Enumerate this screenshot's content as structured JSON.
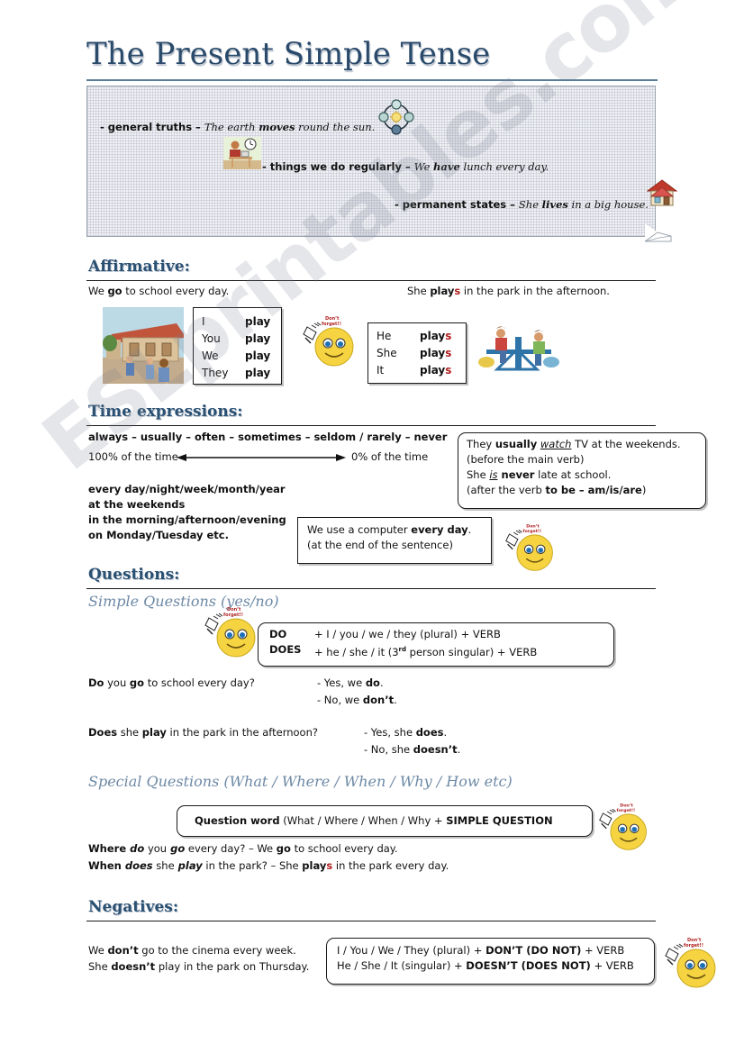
{
  "document": {
    "title": "The Present Simple Tense",
    "watermark": "ESLprintables.com"
  },
  "intro": {
    "lines": [
      {
        "prefix": "- general truths – ",
        "example_pre": "The earth ",
        "example_bold": "moves",
        "example_post": " round the sun."
      },
      {
        "prefix": "- things we do regularly – ",
        "example_pre": "We ",
        "example_bold": "have",
        "example_post": " lunch every day."
      },
      {
        "prefix": "- permanent states – ",
        "example_pre": "She ",
        "example_bold": "lives",
        "example_post": " in a big house."
      }
    ],
    "icons": [
      "earth-orbit-icon",
      "person-at-desk-icon",
      "house-icon"
    ]
  },
  "affirmative": {
    "heading": "Affirmative:",
    "left_sentence_pre": "We ",
    "left_sentence_bold": "go",
    "left_sentence_post": " to school every day.",
    "right_sentence_pre": "She ",
    "right_sentence_bold": "play",
    "right_sentence_bold_s": "s",
    "right_sentence_post": " in the park in the afternoon.",
    "table_left": [
      {
        "pronoun": "I",
        "verb": "play"
      },
      {
        "pronoun": "You",
        "verb": "play"
      },
      {
        "pronoun": "We",
        "verb": "play"
      },
      {
        "pronoun": "They",
        "verb": "play"
      }
    ],
    "table_right": [
      {
        "pronoun": "He",
        "verb": "play",
        "suffix": "s"
      },
      {
        "pronoun": "She",
        "verb": "play",
        "suffix": "s"
      },
      {
        "pronoun": "It",
        "verb": "play",
        "suffix": "s"
      }
    ]
  },
  "time_expressions": {
    "heading": "Time expressions:",
    "adverb_scale": "always – usually – often – sometimes – seldom / rarely – never",
    "scale_left": "100% of the time",
    "scale_right": "0% of the time",
    "expressions": [
      "every day/night/week/month/year",
      "at the weekends",
      "in the morning/afternoon/evening",
      "on Monday/Tuesday etc."
    ],
    "note_box_right": {
      "line1_pre": "They ",
      "line1_bold": "usually",
      "line1_mid": " ",
      "line1_underline": "watch",
      "line1_post": " TV at the weekends.",
      "line2": "(before the main verb)",
      "line3_pre": "She ",
      "line3_italic": "is",
      "line3_bold": " never",
      "line3_post": " late at school.",
      "line4_pre": "(after the verb ",
      "line4_bold": "to be – am/is/are",
      "line4_post": ")"
    },
    "note_box_bottom": {
      "line1_pre": "We use a computer ",
      "line1_bold": "every day",
      "line1_post": ".",
      "line2": "(at the end of the sentence)"
    }
  },
  "questions": {
    "heading": "Questions:",
    "simple_subhead": "Simple Questions (yes/no)",
    "do_box": {
      "rows": [
        {
          "aux": "DO",
          "pattern_pre": "+ I / you / we / they (plural) + VERB",
          "sup": "",
          "pattern_post": ""
        },
        {
          "aux": "DOES",
          "pattern_pre": "+ he / she / it (3",
          "sup": "rd",
          "pattern_post": " person singular) + VERB"
        }
      ]
    },
    "examples": [
      {
        "question_bold": "Do",
        "question_rest_pre": " you ",
        "question_rest_bold": "go",
        "question_rest_post": " to school every day?",
        "answer_yes_pre": "- Yes, we ",
        "answer_yes_bold": "do",
        "answer_yes_post": ".",
        "answer_no_pre": "- No, we ",
        "answer_no_bold": "don’t",
        "answer_no_post": "."
      },
      {
        "question_bold": "Does",
        "question_rest_pre": " she ",
        "question_rest_bold": "play",
        "question_rest_post": " in the park in the afternoon?",
        "answer_yes_pre": "- Yes, she ",
        "answer_yes_bold": "does",
        "answer_yes_post": ".",
        "answer_no_pre": "- No, she ",
        "answer_no_bold": "doesn’t",
        "answer_no_post": "."
      }
    ],
    "special_subhead": "Special Questions (What / Where / When / Why / How etc)",
    "special_box_bold": "Question word",
    "special_box_rest": " (What / Where / When / Why + ",
    "special_box_bold2": "SIMPLE QUESTION",
    "special_examples": [
      {
        "b1": "Where",
        "i1": " do",
        "n1": " you",
        "i2": " go",
        "n2": " every day? – We ",
        "b2": "go",
        "n3": " to school every day."
      },
      {
        "b1": "When",
        "i1": " does",
        "n1": " she",
        "i2": " play",
        "n2": " in the park? – She ",
        "b2": "play",
        "s": "s",
        "n3": " in the park every day."
      }
    ]
  },
  "negatives": {
    "heading": "Negatives:",
    "examples": [
      {
        "pre": "We ",
        "bold": "don’t",
        "post": " go to the cinema every week."
      },
      {
        "pre": "She ",
        "bold": "doesn’t",
        "post": " play in the park on Thursday."
      }
    ],
    "rule_box": [
      {
        "pre": "I / You / We / They (plural) + ",
        "bold": "DON’T (DO NOT)",
        "post": " + VERB"
      },
      {
        "pre": "He / She / It (singular) + ",
        "bold": "DOESN’T (DOES NOT)",
        "post": " + VERB"
      }
    ]
  },
  "colors": {
    "heading_blue": "#2a5072",
    "subhead_blue": "#6d89a6",
    "title_blue": "#2a4a6b",
    "accent_red": "#b02020",
    "intro_bg": "#f1f1f5"
  },
  "smiley_caption": "Don’t forget!"
}
